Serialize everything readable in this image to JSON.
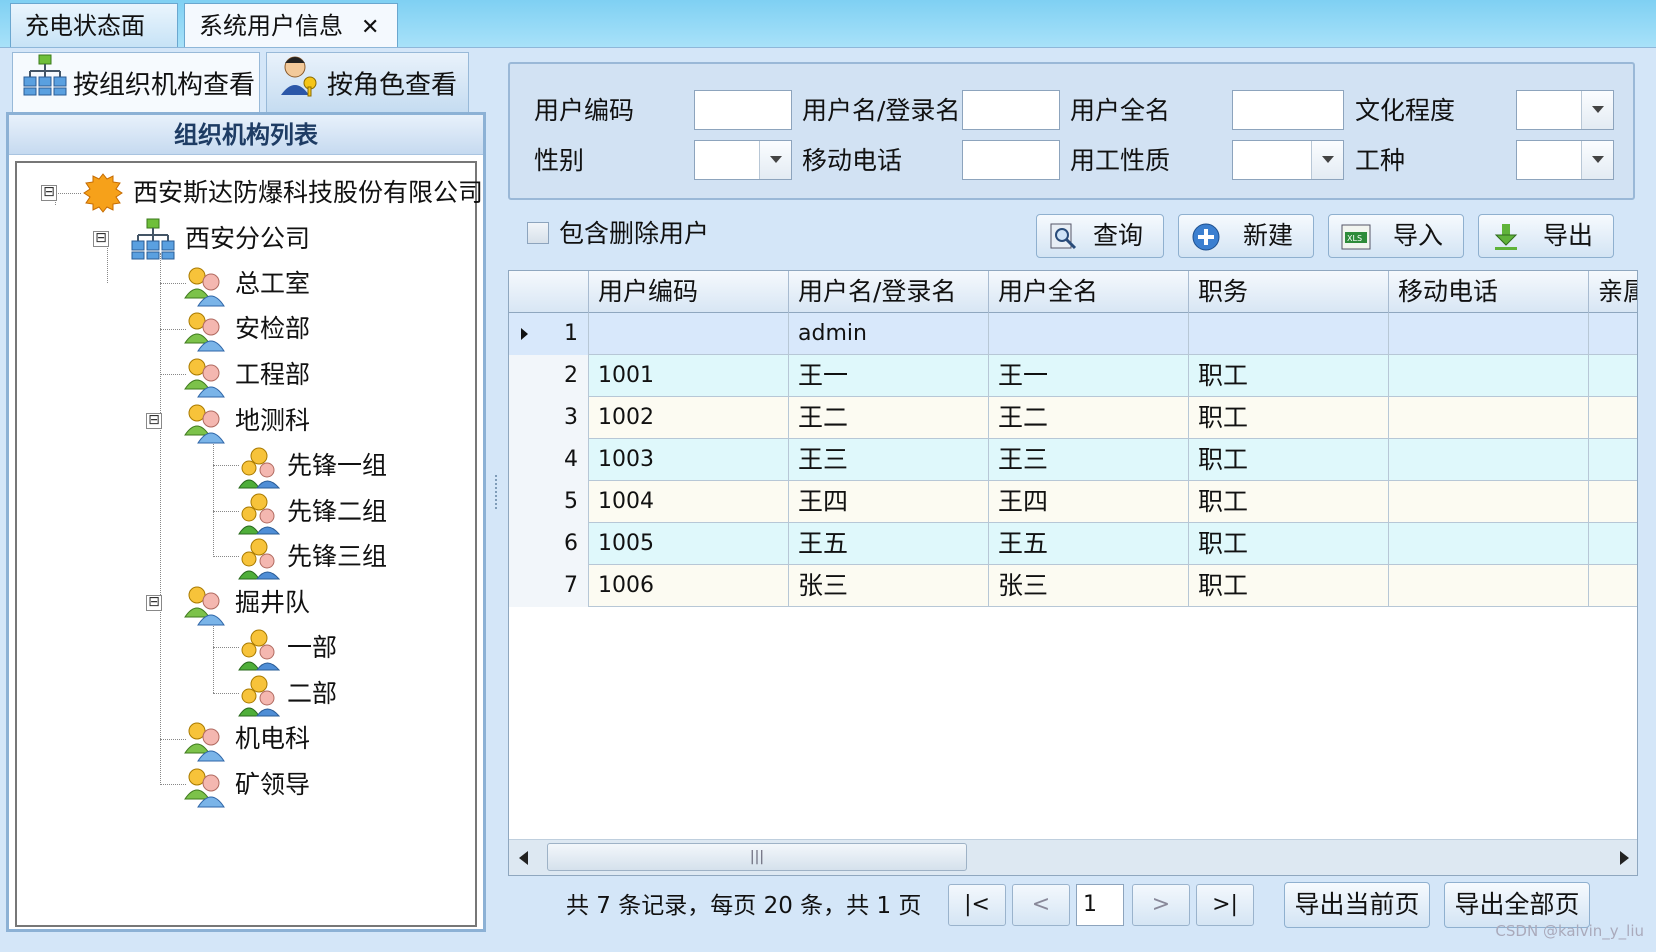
{
  "doc_tabs": [
    {
      "label": "充电状态面板"
    },
    {
      "label": "系统用户信息",
      "close": "✕"
    }
  ],
  "side_tabs": {
    "org": "按组织机构查看",
    "role": "按角色查看"
  },
  "org_panel": {
    "title": "组织机构列表",
    "tree": [
      {
        "label": "西安斯达防爆科技股份有限公司",
        "icon": "company-icon",
        "toggle": "⊟"
      },
      {
        "label": "西安分公司",
        "icon": "org-structure-icon",
        "toggle": "⊟"
      },
      {
        "label": "总工室",
        "icon": "users-icon"
      },
      {
        "label": "安检部",
        "icon": "users-icon"
      },
      {
        "label": "工程部",
        "icon": "users-icon"
      },
      {
        "label": "地测科",
        "icon": "users-icon",
        "toggle": "⊟"
      },
      {
        "label": "先锋一组",
        "icon": "group-icon"
      },
      {
        "label": "先锋二组",
        "icon": "group-icon"
      },
      {
        "label": "先锋三组",
        "icon": "group-icon"
      },
      {
        "label": "掘井队",
        "icon": "users-icon",
        "toggle": "⊟"
      },
      {
        "label": "一部",
        "icon": "group-icon"
      },
      {
        "label": "二部",
        "icon": "group-icon"
      },
      {
        "label": "机电科",
        "icon": "users-icon"
      },
      {
        "label": "矿领导",
        "icon": "users-icon"
      }
    ]
  },
  "filters": {
    "user_code": {
      "label": "用户编码",
      "value": ""
    },
    "username": {
      "label": "用户名/登录名",
      "value": ""
    },
    "full_name": {
      "label": "用户全名",
      "value": ""
    },
    "education": {
      "label": "文化程度",
      "value": ""
    },
    "gender": {
      "label": "性别",
      "value": ""
    },
    "mobile": {
      "label": "移动电话",
      "value": ""
    },
    "employment_type": {
      "label": "用工性质",
      "value": ""
    },
    "job_type": {
      "label": "工种",
      "value": ""
    }
  },
  "include_deleted": {
    "label": "包含删除用户",
    "checked": false
  },
  "toolbar": {
    "query": "查询",
    "new": "新建",
    "import": "导入",
    "export": "导出"
  },
  "grid": {
    "columns": [
      "",
      "用户编码",
      "用户名/登录名",
      "用户全名",
      "职务",
      "移动电话",
      "亲属"
    ],
    "rows": [
      {
        "n": "1",
        "code": "",
        "username": "admin",
        "full_name": "",
        "position": "",
        "mobile": ""
      },
      {
        "n": "2",
        "code": "1001",
        "username": "王一",
        "full_name": "王一",
        "position": "职工",
        "mobile": ""
      },
      {
        "n": "3",
        "code": "1002",
        "username": "王二",
        "full_name": "王二",
        "position": "职工",
        "mobile": ""
      },
      {
        "n": "4",
        "code": "1003",
        "username": "王三",
        "full_name": "王三",
        "position": "职工",
        "mobile": ""
      },
      {
        "n": "5",
        "code": "1004",
        "username": "王四",
        "full_name": "王四",
        "position": "职工",
        "mobile": ""
      },
      {
        "n": "6",
        "code": "1005",
        "username": "王五",
        "full_name": "王五",
        "position": "职工",
        "mobile": ""
      },
      {
        "n": "7",
        "code": "1006",
        "username": "张三",
        "full_name": "张三",
        "position": "职工",
        "mobile": ""
      }
    ],
    "scroll_thumb": "|||"
  },
  "pager": {
    "info": "共 7 条记录，每页 20 条，共 1 页",
    "first": "|<",
    "prev": "<",
    "page": "1",
    "next": ">",
    "last": ">|",
    "export_current": "导出当前页",
    "export_all": "导出全部页"
  },
  "watermark": "CSDN @kalvin_y_liu",
  "colors": {
    "row_even": "#dff8fb",
    "row_odd": "#fcfbf2",
    "row_selected": "#d8e8fb",
    "frame": "#d4e6f8",
    "accent": "#8cb1d5"
  }
}
